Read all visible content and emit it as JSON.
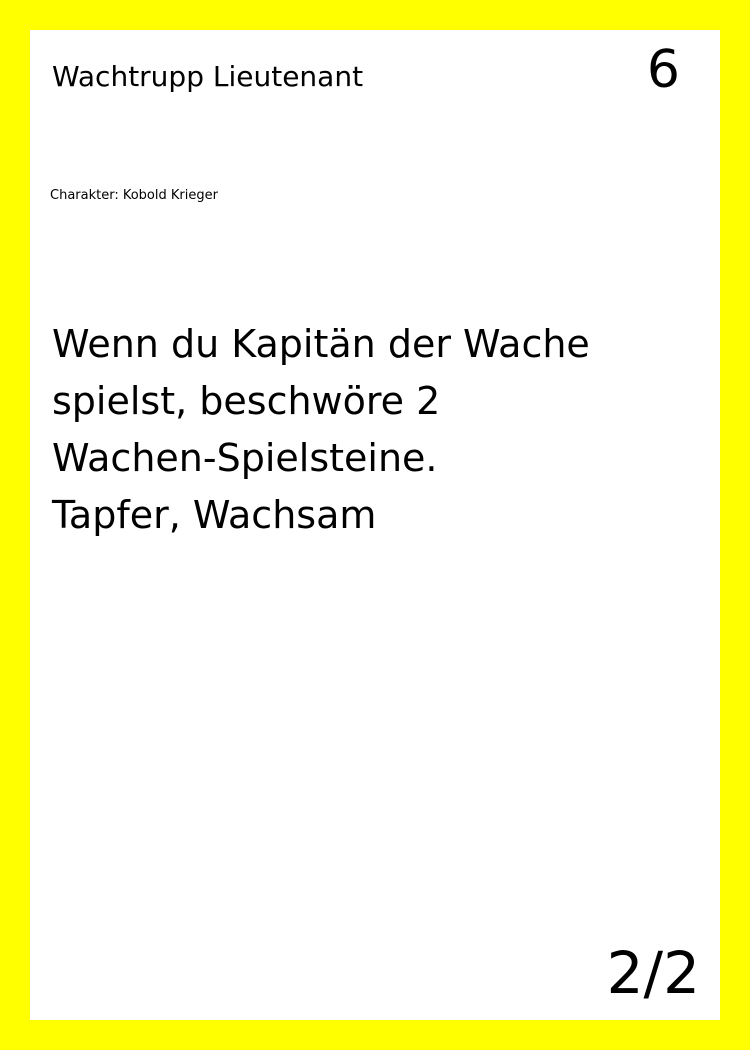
{
  "colors": {
    "border": "#ffff00",
    "card_background": "#ffffff",
    "text": "#000000"
  },
  "card": {
    "title": "Wachtrupp Lieutenant",
    "cost": "6",
    "character": "Charakter: Kobold Krieger",
    "text_lines": [
      "Wenn du Kapitän der Wache",
      "spielst, beschwöre 2",
      "Wachen-Spielsteine.",
      "Tapfer, Wachsam"
    ],
    "page": "2/2"
  }
}
